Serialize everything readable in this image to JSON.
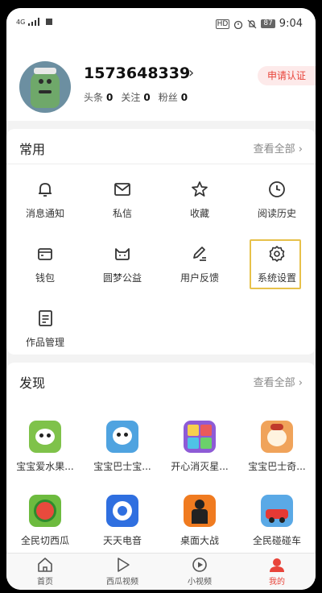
{
  "status_bar": {
    "carrier": "4G",
    "hd": "HD",
    "battery": "87",
    "time": "9:04"
  },
  "profile": {
    "user_id": "1573648339",
    "arrow": "›",
    "stats": [
      {
        "label": "头条",
        "value": "0"
      },
      {
        "label": "关注",
        "value": "0"
      },
      {
        "label": "粉丝",
        "value": "0"
      }
    ],
    "cert_button": "申请认证"
  },
  "common": {
    "title": "常用",
    "see_all": "查看全部 ›",
    "items": [
      {
        "label": "消息通知",
        "icon": "bell-icon"
      },
      {
        "label": "私信",
        "icon": "message-icon"
      },
      {
        "label": "收藏",
        "icon": "star-icon"
      },
      {
        "label": "阅读历史",
        "icon": "clock-icon"
      },
      {
        "label": "钱包",
        "icon": "wallet-icon"
      },
      {
        "label": "圆梦公益",
        "icon": "charity-icon"
      },
      {
        "label": "用户反馈",
        "icon": "feedback-icon"
      },
      {
        "label": "系统设置",
        "icon": "gear-icon"
      },
      {
        "label": "作品管理",
        "icon": "works-icon"
      }
    ]
  },
  "discover": {
    "title": "发现",
    "see_all": "查看全部 ›",
    "apps": [
      {
        "label": "宝宝爱水果...",
        "color": "#7fc24a"
      },
      {
        "label": "宝宝巴士宝...",
        "color": "#4fa3e0"
      },
      {
        "label": "开心消灭星...",
        "color": "#8e5bd6"
      },
      {
        "label": "宝宝巴士奇...",
        "color": "#f0a35a"
      },
      {
        "label": "全民切西瓜",
        "color": "#6dbb3f"
      },
      {
        "label": "天天电音",
        "color": "#2f6fe0"
      },
      {
        "label": "桌面大战",
        "color": "#f07b20"
      },
      {
        "label": "全民碰碰车",
        "color": "#5aa9e6"
      }
    ]
  },
  "tabs": [
    {
      "label": "首页",
      "icon": "home-icon"
    },
    {
      "label": "西瓜视频",
      "icon": "play-icon"
    },
    {
      "label": "小视频",
      "icon": "short-video-icon"
    },
    {
      "label": "我的",
      "icon": "profile-icon"
    }
  ],
  "colors": {
    "accent": "#e8443a",
    "highlight": "#e7c14a"
  }
}
